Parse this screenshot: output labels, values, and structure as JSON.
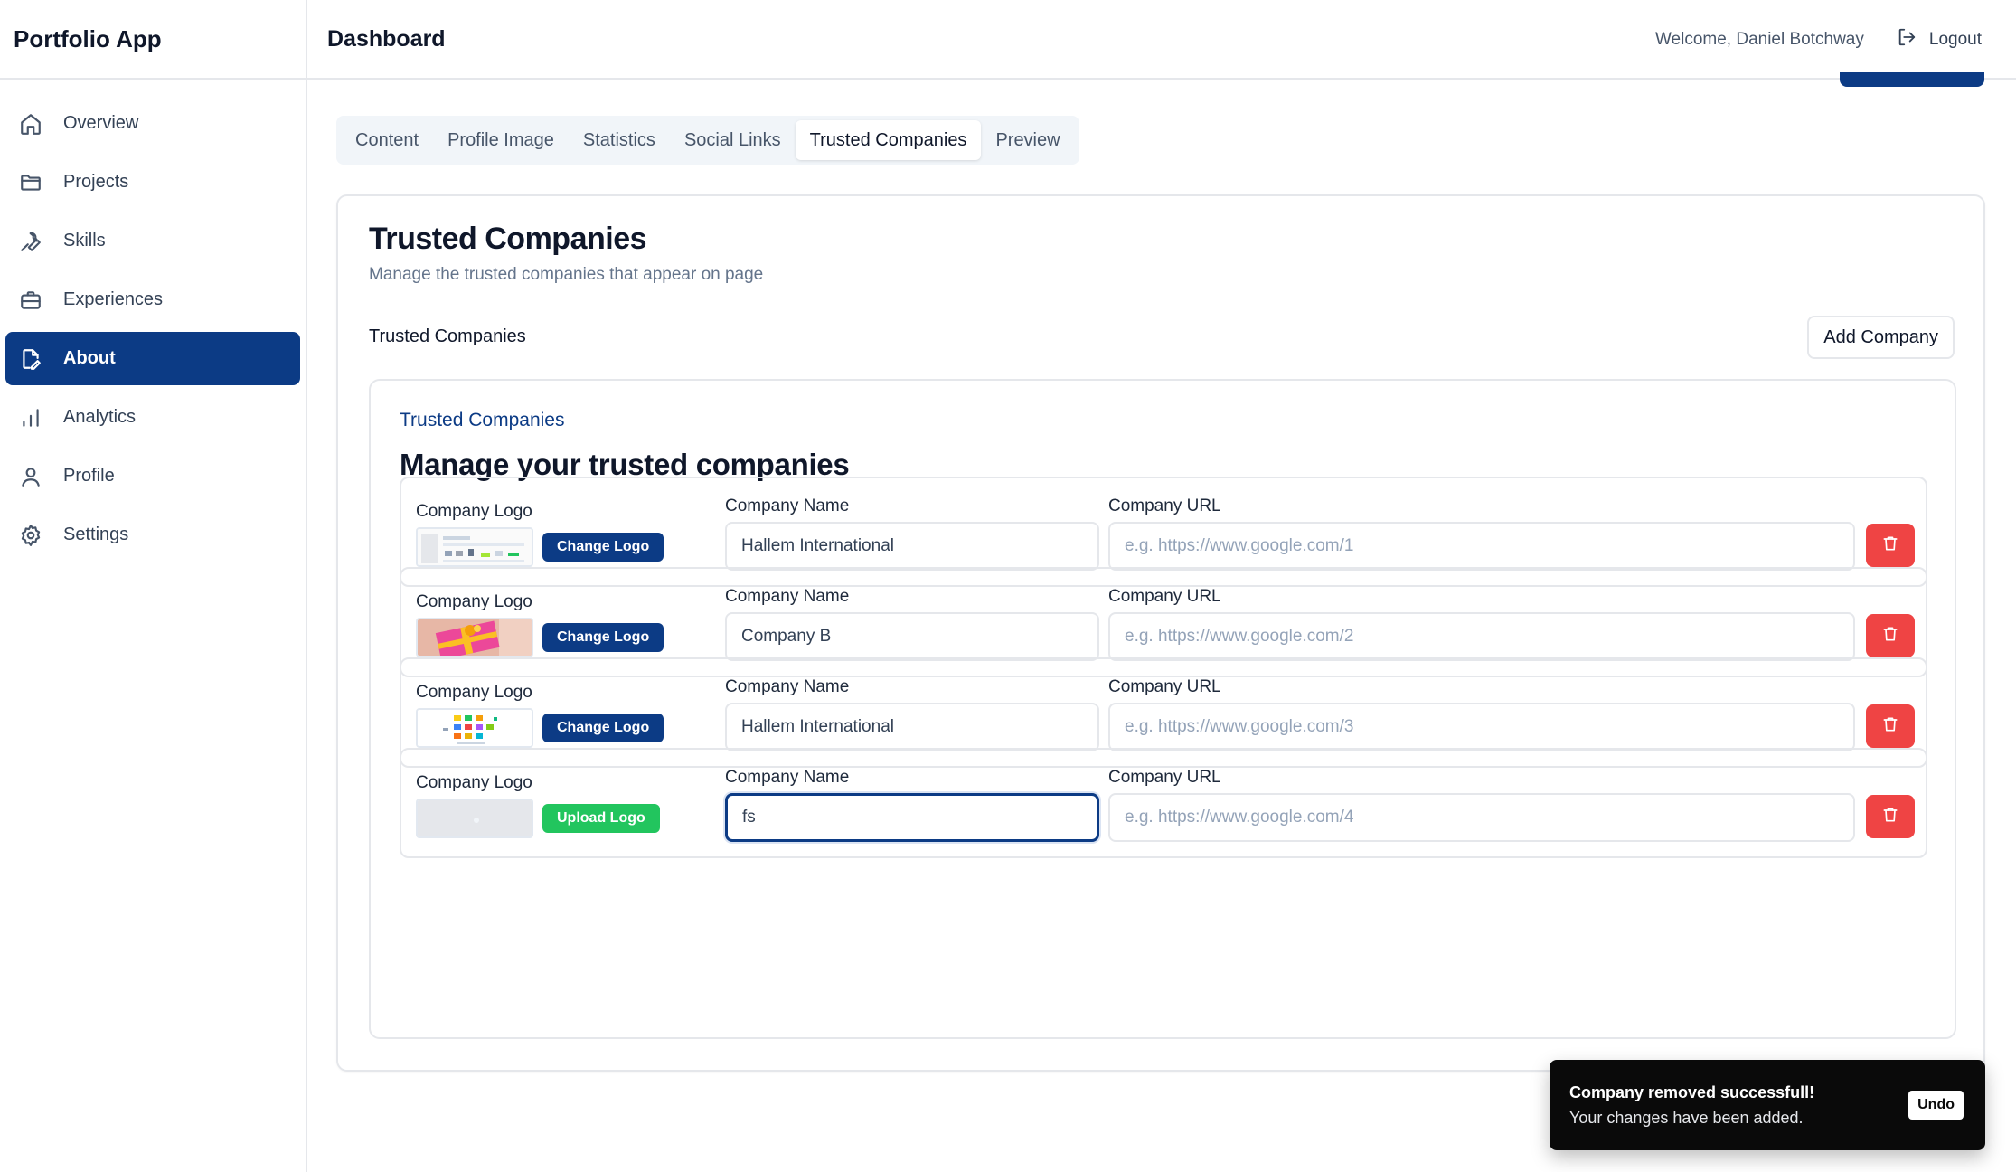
{
  "app": {
    "name": "Portfolio App"
  },
  "sidebar": {
    "items": [
      {
        "label": "Overview",
        "icon": "home-icon"
      },
      {
        "label": "Projects",
        "icon": "folder-icon"
      },
      {
        "label": "Skills",
        "icon": "wrench-icon"
      },
      {
        "label": "Experiences",
        "icon": "briefcase-icon"
      },
      {
        "label": "About",
        "icon": "file-edit-icon",
        "active": true
      },
      {
        "label": "Analytics",
        "icon": "bar-chart-icon"
      },
      {
        "label": "Profile",
        "icon": "user-icon"
      },
      {
        "label": "Settings",
        "icon": "gear-icon"
      }
    ]
  },
  "header": {
    "title": "Dashboard",
    "welcome": "Welcome, Daniel Botchway",
    "logout": "Logout"
  },
  "tabs": [
    {
      "label": "Content"
    },
    {
      "label": "Profile Image"
    },
    {
      "label": "Statistics"
    },
    {
      "label": "Social Links"
    },
    {
      "label": "Trusted Companies",
      "active": true
    },
    {
      "label": "Preview"
    }
  ],
  "card": {
    "title": "Trusted Companies",
    "subtitle": "Manage the trusted companies that appear on page",
    "section_label": "Trusted Companies",
    "add_button": "Add Company",
    "inner_kicker": "Trusted Companies",
    "inner_heading": "Manage your trusted companies"
  },
  "field_labels": {
    "logo": "Company Logo",
    "name": "Company Name",
    "url": "Company URL"
  },
  "companies": [
    {
      "name": "Hallem International",
      "url_placeholder": "e.g. https://www.google.com/1",
      "logo_button": "Change Logo",
      "logo_style": "screenshot"
    },
    {
      "name": "Company B",
      "url_placeholder": "e.g. https://www.google.com/2",
      "logo_button": "Change Logo",
      "logo_style": "gift"
    },
    {
      "name": "Hallem International",
      "url_placeholder": "e.g. https://www.google.com/3",
      "logo_button": "Change Logo",
      "logo_style": "colorful-grid"
    },
    {
      "name": "fs",
      "url_placeholder": "e.g. https://www.google.com/4",
      "logo_button": "Upload Logo",
      "logo_style": "empty"
    }
  ],
  "toast": {
    "title": "Company removed successfull!",
    "message": "Your changes have been added.",
    "action": "Undo"
  },
  "colors": {
    "primary": "#0c3b85",
    "danger": "#ef4444",
    "success": "#22c55e"
  }
}
